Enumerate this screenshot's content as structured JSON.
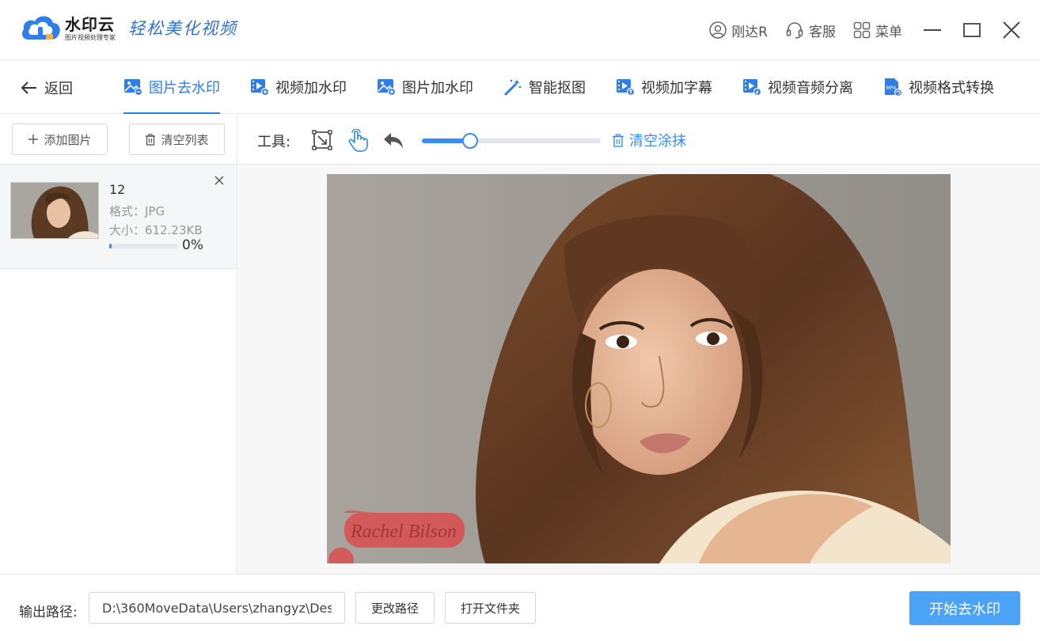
{
  "app": {
    "name": "水印云",
    "subname": "图片视频处理专家",
    "slogan": "轻松美化视频",
    "user": "刚达R",
    "service": "客服",
    "menu": "菜单"
  },
  "nav": {
    "back": "返回",
    "tabs": [
      {
        "label": "图片去水印",
        "icon": "image-remove-icon",
        "active": true
      },
      {
        "label": "视频加水印",
        "icon": "video-add-icon",
        "active": false
      },
      {
        "label": "图片加水印",
        "icon": "image-add-icon",
        "active": false
      },
      {
        "label": "智能抠图",
        "icon": "magic-wand-icon",
        "active": false
      },
      {
        "label": "视频加字幕",
        "icon": "video-subtitle-icon",
        "active": false
      },
      {
        "label": "视频音频分离",
        "icon": "video-audio-icon",
        "active": false
      },
      {
        "label": "视频格式转换",
        "icon": "mp4-file-icon",
        "active": false
      }
    ]
  },
  "left": {
    "add_label": "添加图片",
    "clear_label": "清空列表",
    "file": {
      "name": "12",
      "format": "格式：JPG",
      "size": "大小：612.23KB",
      "progress_label": "0%",
      "progress": 0.03
    }
  },
  "toolbar": {
    "label": "工具:",
    "brush_level": 0.27,
    "clear_smear": "清空涂抹"
  },
  "bottom": {
    "output_label": "输出路径:",
    "output_path": "D:\\360MoveData\\Users\\zhangyz\\Des",
    "change_path": "更改路径",
    "open_folder": "打开文件夹",
    "start": "开始去水印"
  },
  "colors": {
    "accent": "#2f7ee8",
    "primary_button": "#4aa3f7",
    "smear": "#d95050"
  }
}
